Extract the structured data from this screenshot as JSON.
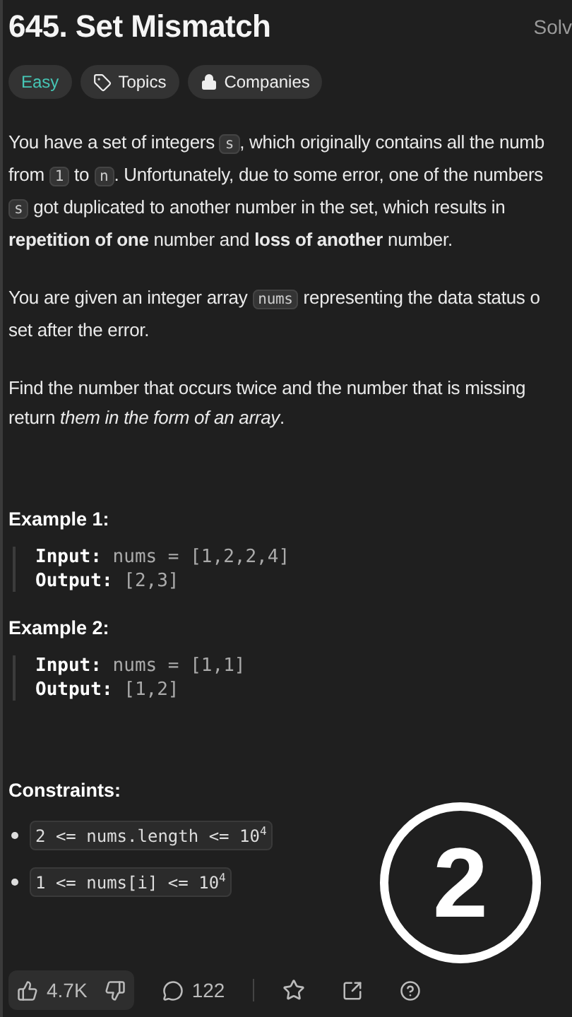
{
  "title": "645. Set Mismatch",
  "solved_label": "Solv",
  "tags": [
    {
      "kind": "difficulty",
      "label": "Easy"
    },
    {
      "kind": "topics",
      "label": "Topics"
    },
    {
      "kind": "companies",
      "label": "Companies"
    }
  ],
  "paragraphs": [
    [
      [
        {
          "t": "You have a set of integers "
        },
        {
          "t": "s",
          "code": true
        },
        {
          "t": ", which originally contains all the numb"
        }
      ],
      [
        {
          "t": "from "
        },
        {
          "t": "1",
          "code": true
        },
        {
          "t": " to "
        },
        {
          "t": "n",
          "code": true
        },
        {
          "t": ". Unfortunately, due to some error, one of the numbers"
        }
      ],
      [
        {
          "t": "s",
          "code": true
        },
        {
          "t": " got duplicated to another number in the set, which results in"
        }
      ],
      [
        {
          "t": "**repetition of one** number and **loss of another** number."
        }
      ]
    ],
    [
      [
        {
          "t": "You are given an integer array "
        },
        {
          "t": "nums",
          "code": true
        },
        {
          "t": " representing the data status o"
        }
      ],
      [
        {
          "t": "set after the error."
        }
      ]
    ],
    [
      [
        {
          "t": "Find the number that occurs twice and the number that is missing"
        }
      ],
      [
        {
          "t": "return *them in the form of an array*."
        }
      ]
    ]
  ],
  "examples": [
    {
      "title": "Example 1:",
      "lines": [
        {
          "label": "Input:",
          "value": "nums = [1,2,2,4]"
        },
        {
          "label": "Output:",
          "value": "[2,3]"
        }
      ]
    },
    {
      "title": "Example 2:",
      "lines": [
        {
          "label": "Input:",
          "value": "nums = [1,1]"
        },
        {
          "label": "Output:",
          "value": "[1,2]"
        }
      ]
    }
  ],
  "constraints_title": "Constraints:",
  "constraints": [
    "2 <= nums.length <= 10$^{4}$",
    "1 <= nums[i] <= 10$^{4}$"
  ],
  "footer": {
    "likes": "4.7K",
    "comments": "122"
  },
  "step_badge": "2"
}
